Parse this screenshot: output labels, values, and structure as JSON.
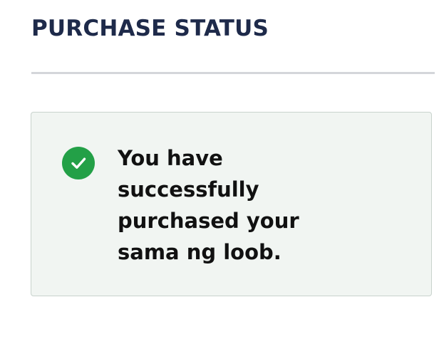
{
  "header": {
    "title": "PURCHASE STATUS"
  },
  "status": {
    "icon": "check-circle-icon",
    "message": "You have successfully purchased your sama ng loob.",
    "accent_color": "#23a047",
    "card_background": "#f1f5f2"
  }
}
